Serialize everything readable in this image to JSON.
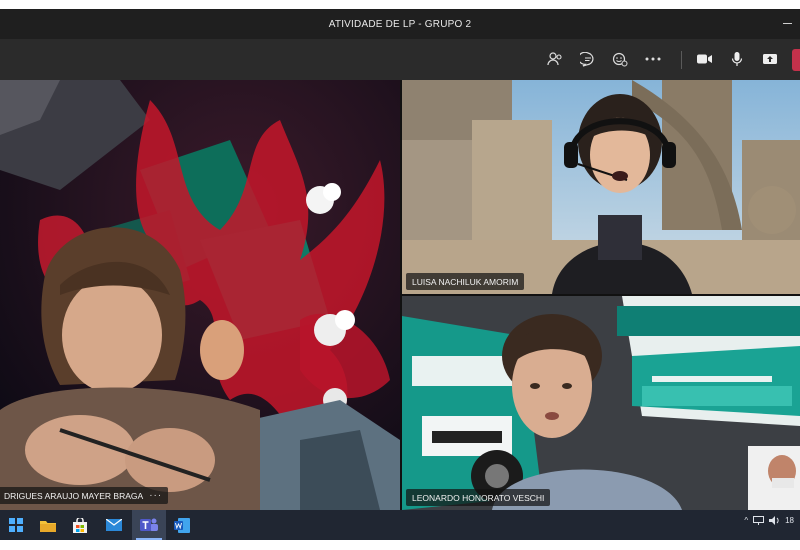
{
  "window": {
    "title": "ATIVIDADE DE LP - GRUPO 2"
  },
  "toolbar": {
    "buttons": [
      {
        "name": "participants-icon"
      },
      {
        "name": "chat-icon"
      },
      {
        "name": "reactions-icon"
      },
      {
        "name": "more-options-icon"
      },
      {
        "name": "camera-icon"
      },
      {
        "name": "microphone-icon"
      },
      {
        "name": "share-screen-icon"
      },
      {
        "name": "hang-up-icon"
      }
    ]
  },
  "participants": [
    {
      "name": "DRIGUES ARAUJO MAYER BRAGA",
      "more": "···"
    },
    {
      "name": "LUISA NACHILUK AMORIM"
    },
    {
      "name": "LEONARDO HONORATO VESCHI"
    }
  ],
  "taskbar": {
    "apps": [
      "windows-start-icon",
      "file-explorer-icon",
      "store-icon",
      "mail-icon",
      "teams-icon",
      "word-icon"
    ],
    "tray_clock": "18"
  },
  "colors": {
    "titlebar": "#1f1f1f",
    "toolbar": "#2b2b2b",
    "hangup": "#c4314b",
    "taskbar": "#202632"
  }
}
